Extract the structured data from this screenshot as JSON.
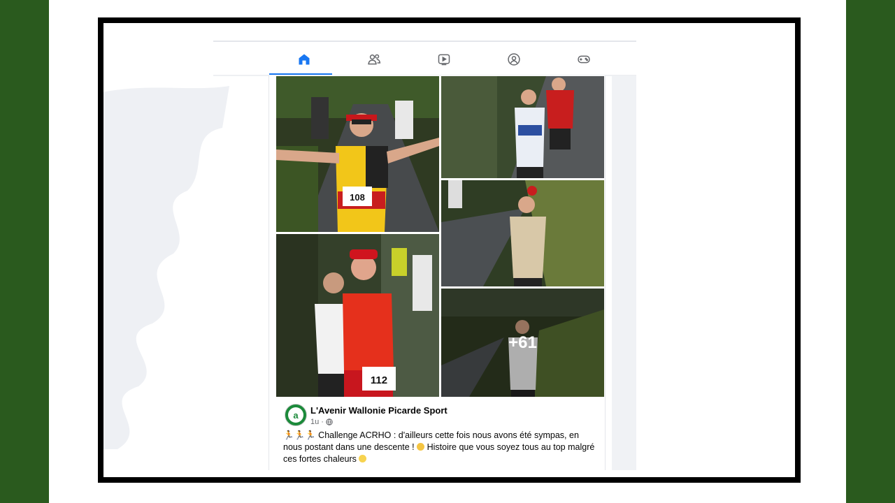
{
  "nav": {
    "tabs": [
      {
        "name": "home-icon",
        "active": true
      },
      {
        "name": "friends-icon",
        "active": false
      },
      {
        "name": "video-icon",
        "active": false
      },
      {
        "name": "groups-icon",
        "active": false
      },
      {
        "name": "gaming-icon",
        "active": false
      }
    ]
  },
  "colors": {
    "accent": "#1877f2",
    "side_green": "#2a5a1e"
  },
  "post": {
    "photos": [
      {
        "name": "runner-108",
        "bib": "108"
      },
      {
        "name": "runner-older",
        "bib": ""
      },
      {
        "name": "runner-tan-shirt",
        "bib": ""
      },
      {
        "name": "runner-112",
        "bib": "112"
      },
      {
        "name": "runner-white-shirt",
        "bib": ""
      }
    ],
    "more_count": "+61",
    "author": "L'Avenir Wallonie Picarde Sport",
    "time": "1u ·",
    "avatar_letter": "a",
    "text_main": " Challenge ACRHO : d'ailleurs cette fois nous avons été sympas, en nous postant dans une descente ! ",
    "text_tail": " Histoire que vous soyez tous au top malgré ces fortes chaleurs "
  }
}
